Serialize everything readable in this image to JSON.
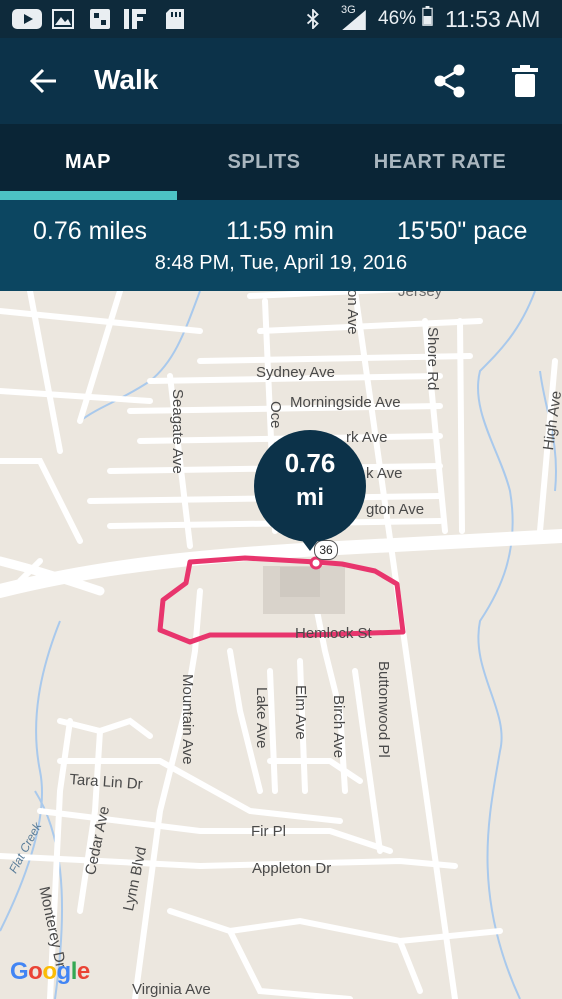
{
  "status_bar": {
    "battery": "46%",
    "network": "3G",
    "time": "11:53 AM"
  },
  "app_bar": {
    "title": "Walk"
  },
  "tabs": [
    {
      "label": "MAP",
      "active": true
    },
    {
      "label": "SPLITS",
      "active": false
    },
    {
      "label": "HEART RATE",
      "active": false
    }
  ],
  "summary": {
    "distance": "0.76 miles",
    "duration": "11:59 min",
    "pace": "15'50\" pace",
    "datetime": "8:48 PM, Tue, April 19, 2016"
  },
  "map": {
    "pin": {
      "value": "0.76",
      "unit": "mi"
    },
    "route_shield": "36",
    "streets": {
      "sydney": "Sydney Ave",
      "morningside": "Morningside Ave",
      "ark": "rk Ave",
      "kave": "k Ave",
      "gton": "gton Ave",
      "hemlock": "Hemlock St",
      "seagate": "Seagate Ave",
      "ocean": "Oce",
      "onave": "on Ave",
      "shore": "Shore Rd",
      "high": "High Ave",
      "mountain": "Mountain Ave",
      "lake": "Lake Ave",
      "elm": "Elm Ave",
      "birch": "Birch Ave",
      "buttonwood": "Buttonwood Pl",
      "taralin": "Tara Lin Dr",
      "fir": "Fir Pl",
      "appleton": "Appleton Dr",
      "cedar": "Cedar Ave",
      "lynn": "Lynn Blvd",
      "monterey": "Monterey Dr",
      "virginia": "Virginia Ave",
      "jersey": "Jersey",
      "flatcreek": "Flat Creek"
    },
    "attribution": "Google",
    "route_color": "#e8356d"
  },
  "colors": {
    "status_bar": "#0e2a3b",
    "app_bar": "#0c3249",
    "tabs_bg": "#0a2536",
    "tab_indicator": "#4cc2c4",
    "summary_bg": "#0c4661",
    "map_bg": "#ece7df"
  }
}
